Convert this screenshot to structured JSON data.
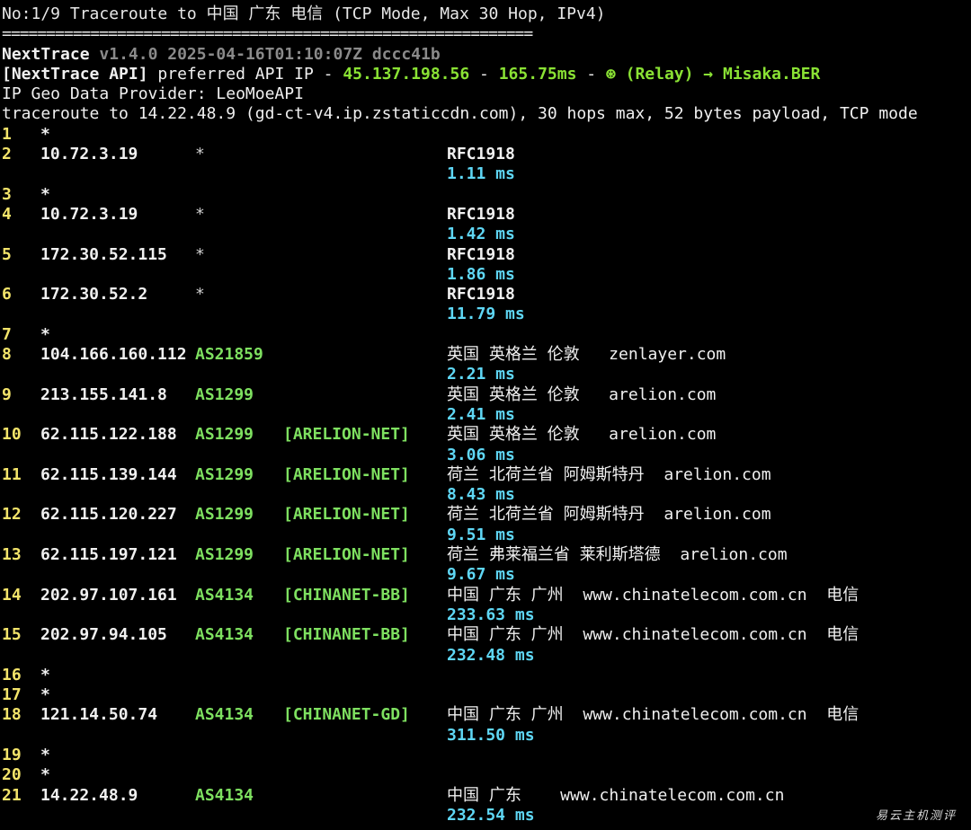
{
  "header": {
    "title": "No:1/9 Traceroute to 中国 广东 电信 (TCP Mode, Max 30 Hop, IPv4)",
    "separator": "============================================================",
    "app_name": "NextTrace",
    "version_info": "v1.4.0 2025-04-16T01:10:07Z dccc41b",
    "api_label": "[NextTrace API]",
    "api_text": " preferred API IP - ",
    "api_ip": "45.137.198.56",
    "api_dash1": " - ",
    "api_latency": "165.75ms",
    "api_dash2": " - ",
    "api_relay": "⊛ (Relay) → Misaka.BER",
    "geo_provider": "IP Geo Data Provider: LeoMoeAPI",
    "trace_summary": "traceroute to 14.22.48.9 (gd-ct-v4.ip.zstaticcdn.com), 30 hops max, 52 bytes payload, TCP mode"
  },
  "hops": [
    {
      "num": "1",
      "star": "*"
    },
    {
      "num": "2",
      "ip": "10.72.3.19",
      "asn": "*",
      "geo": "RFC1918",
      "rtt": "1.11 ms"
    },
    {
      "num": "3",
      "star": "*"
    },
    {
      "num": "4",
      "ip": "10.72.3.19",
      "asn": "*",
      "geo": "RFC1918",
      "rtt": "1.42 ms"
    },
    {
      "num": "5",
      "ip": "172.30.52.115",
      "asn": "*",
      "geo": "RFC1918",
      "rtt": "1.86 ms"
    },
    {
      "num": "6",
      "ip": "172.30.52.2",
      "asn": "*",
      "geo": "RFC1918",
      "rtt": "11.79 ms"
    },
    {
      "num": "7",
      "star": "*"
    },
    {
      "num": "8",
      "ip": "104.166.160.112",
      "asn": "AS21859",
      "net": "",
      "geo": "英国 英格兰 伦敦   zenlayer.com",
      "rtt": "2.21 ms"
    },
    {
      "num": "9",
      "ip": "213.155.141.8",
      "asn": "AS1299",
      "net": "",
      "geo": "英国 英格兰 伦敦   arelion.com",
      "rtt": "2.41 ms"
    },
    {
      "num": "10",
      "ip": "62.115.122.188",
      "asn": "AS1299",
      "net": "[ARELION-NET]",
      "geo": "英国 英格兰 伦敦   arelion.com",
      "rtt": "3.06 ms"
    },
    {
      "num": "11",
      "ip": "62.115.139.144",
      "asn": "AS1299",
      "net": "[ARELION-NET]",
      "geo": "荷兰 北荷兰省 阿姆斯特丹  arelion.com",
      "rtt": "8.43 ms"
    },
    {
      "num": "12",
      "ip": "62.115.120.227",
      "asn": "AS1299",
      "net": "[ARELION-NET]",
      "geo": "荷兰 北荷兰省 阿姆斯特丹  arelion.com",
      "rtt": "9.51 ms"
    },
    {
      "num": "13",
      "ip": "62.115.197.121",
      "asn": "AS1299",
      "net": "[ARELION-NET]",
      "geo": "荷兰 弗莱福兰省 莱利斯塔德  arelion.com",
      "rtt": "9.67 ms"
    },
    {
      "num": "14",
      "ip": "202.97.107.161",
      "asn": "AS4134",
      "net": "[CHINANET-BB]",
      "geo": "中国 广东 广州  www.chinatelecom.com.cn  电信",
      "rtt": "233.63 ms"
    },
    {
      "num": "15",
      "ip": "202.97.94.105",
      "asn": "AS4134",
      "net": "[CHINANET-BB]",
      "geo": "中国 广东 广州  www.chinatelecom.com.cn  电信",
      "rtt": "232.48 ms"
    },
    {
      "num": "16",
      "star": "*"
    },
    {
      "num": "17",
      "star": "*"
    },
    {
      "num": "18",
      "ip": "121.14.50.74",
      "asn": "AS4134",
      "net": "[CHINANET-GD]",
      "geo": "中国 广东 广州  www.chinatelecom.com.cn  电信",
      "rtt": "311.50 ms"
    },
    {
      "num": "19",
      "star": "*"
    },
    {
      "num": "20",
      "star": "*"
    },
    {
      "num": "21",
      "ip": "14.22.48.9",
      "asn": "AS4134",
      "net": "",
      "geo": "中国 广东    www.chinatelecom.com.cn",
      "rtt": "232.54 ms"
    }
  ],
  "watermark": "易云主机测评",
  "colors": {
    "background": "#000000",
    "hop_number": "#f3e46a",
    "asn": "#7ee060",
    "rtt": "#5fd7f5",
    "api_highlight": "#8ae234",
    "dim": "#8a8a8a"
  }
}
